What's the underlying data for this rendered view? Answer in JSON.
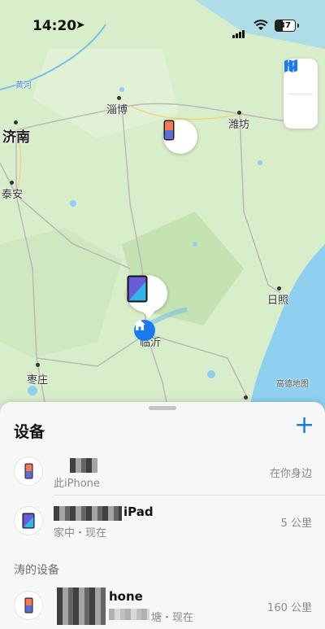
{
  "status_bar": {
    "time": "14:20",
    "battery": "37"
  },
  "map": {
    "cities": {
      "jinan": "济南",
      "zibo": "淄博",
      "weifang": "潍坊",
      "taian": "泰安",
      "rizhao": "日照",
      "linyi": "临沂",
      "zaozhuang": "枣庄",
      "huanghe": "黄河"
    },
    "attribution": "高德地图",
    "colors": {
      "land": "#d8eecb",
      "water": "#8fd0f0",
      "accent": "#1a7af0"
    }
  },
  "sheet": {
    "title": "设备",
    "add_icon": "plus-icon",
    "devices": [
      {
        "name": "",
        "sub": "此iPhone",
        "distance": "在你身边"
      },
      {
        "name": "iPad",
        "sub": "家中・现在",
        "distance": "5 公里"
      }
    ],
    "section_title": "涛的设备",
    "family_devices": [
      {
        "name": "hone",
        "sub": "塘・现在",
        "distance": "160 公里"
      }
    ]
  }
}
